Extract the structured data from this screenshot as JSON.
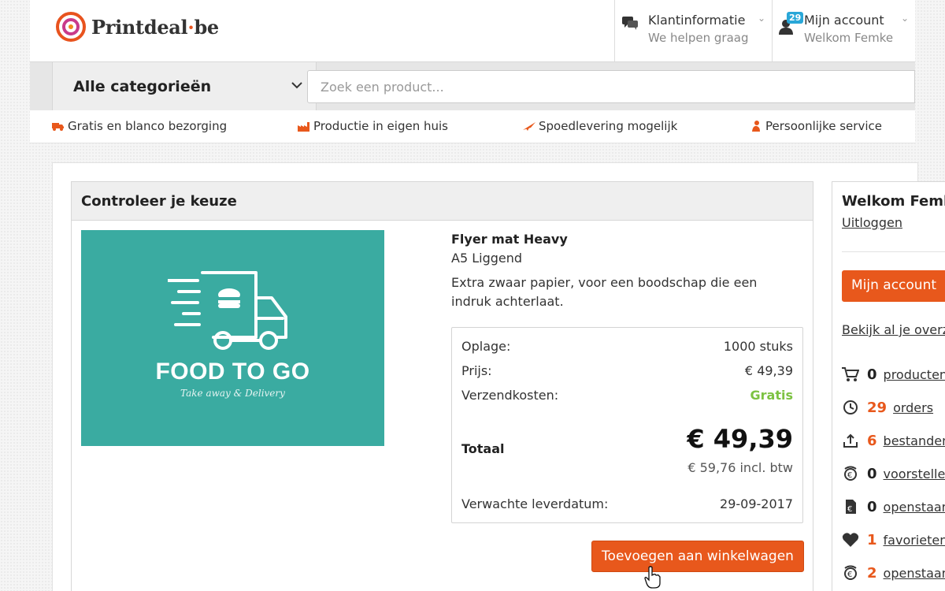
{
  "brand": {
    "logo_name": "Printdeal",
    "logo_dot": "·",
    "logo_tld": "be",
    "accent": "#e8581c",
    "teal": "#3aaba1",
    "green": "#7dc242"
  },
  "header": {
    "klant": {
      "title": "Klantinformatie",
      "sub": "We helpen graag",
      "icon": "chat-bubbles-icon"
    },
    "account": {
      "title": "Mijn account",
      "sub": "Welkom Femke",
      "badge": "29",
      "icon": "user-icon"
    }
  },
  "catbar": {
    "category_label": "Alle categorieën",
    "search_placeholder": "Zoek een product..."
  },
  "usp": [
    {
      "label": "Gratis en blanco bezorging",
      "icon": "truck-icon"
    },
    {
      "label": "Productie in eigen huis",
      "icon": "factory-icon"
    },
    {
      "label": "Spoedlevering mogelijk",
      "icon": "plane-icon"
    },
    {
      "label": "Persoonlijke service",
      "icon": "person-icon"
    }
  ],
  "check": {
    "title": "Controleer je keuze",
    "image": {
      "title": "FOOD TO GO",
      "subtitle": "Take away & Delivery"
    },
    "product_name": "Flyer mat Heavy",
    "variant": "A5 Liggend",
    "description": "Extra zwaar papier, voor een boodschap die een indruk achterlaat.",
    "summary": {
      "oplage_label": "Oplage:",
      "oplage_value": "1000 stuks",
      "prijs_label": "Prijs:",
      "prijs_value": "€ 49,39",
      "verzend_label": "Verzendkosten:",
      "verzend_value": "Gratis",
      "totaal_label": "Totaal",
      "totaal_value": "€ 49,39",
      "incl_btw": "€ 59,76 incl. btw",
      "lever_label": "Verwachte leverdatum:",
      "lever_value": "29-09-2017"
    },
    "add_button": "Toevoegen aan winkelwagen"
  },
  "welcome": {
    "title": "Welkom Femke",
    "logout": "Uitloggen",
    "account_button": "Mijn account",
    "view_all": "Bekijk al je overzichten",
    "stats": [
      {
        "count": "0",
        "label": "producten",
        "icon": "cart-icon",
        "highlight": false
      },
      {
        "count": "29",
        "label": "orders",
        "icon": "clock-icon",
        "highlight": true
      },
      {
        "count": "6",
        "label": "bestanden",
        "icon": "upload-icon",
        "highlight": true
      },
      {
        "count": "0",
        "label": "voorstellen",
        "icon": "euro-circle-icon",
        "highlight": false
      },
      {
        "count": "0",
        "label": "openstaand",
        "icon": "euro-doc-icon",
        "highlight": false
      },
      {
        "count": "1",
        "label": "favorieten",
        "icon": "heart-icon",
        "highlight": true
      },
      {
        "count": "2",
        "label": "openstaand",
        "icon": "euro-circle-icon",
        "highlight": true
      }
    ]
  }
}
